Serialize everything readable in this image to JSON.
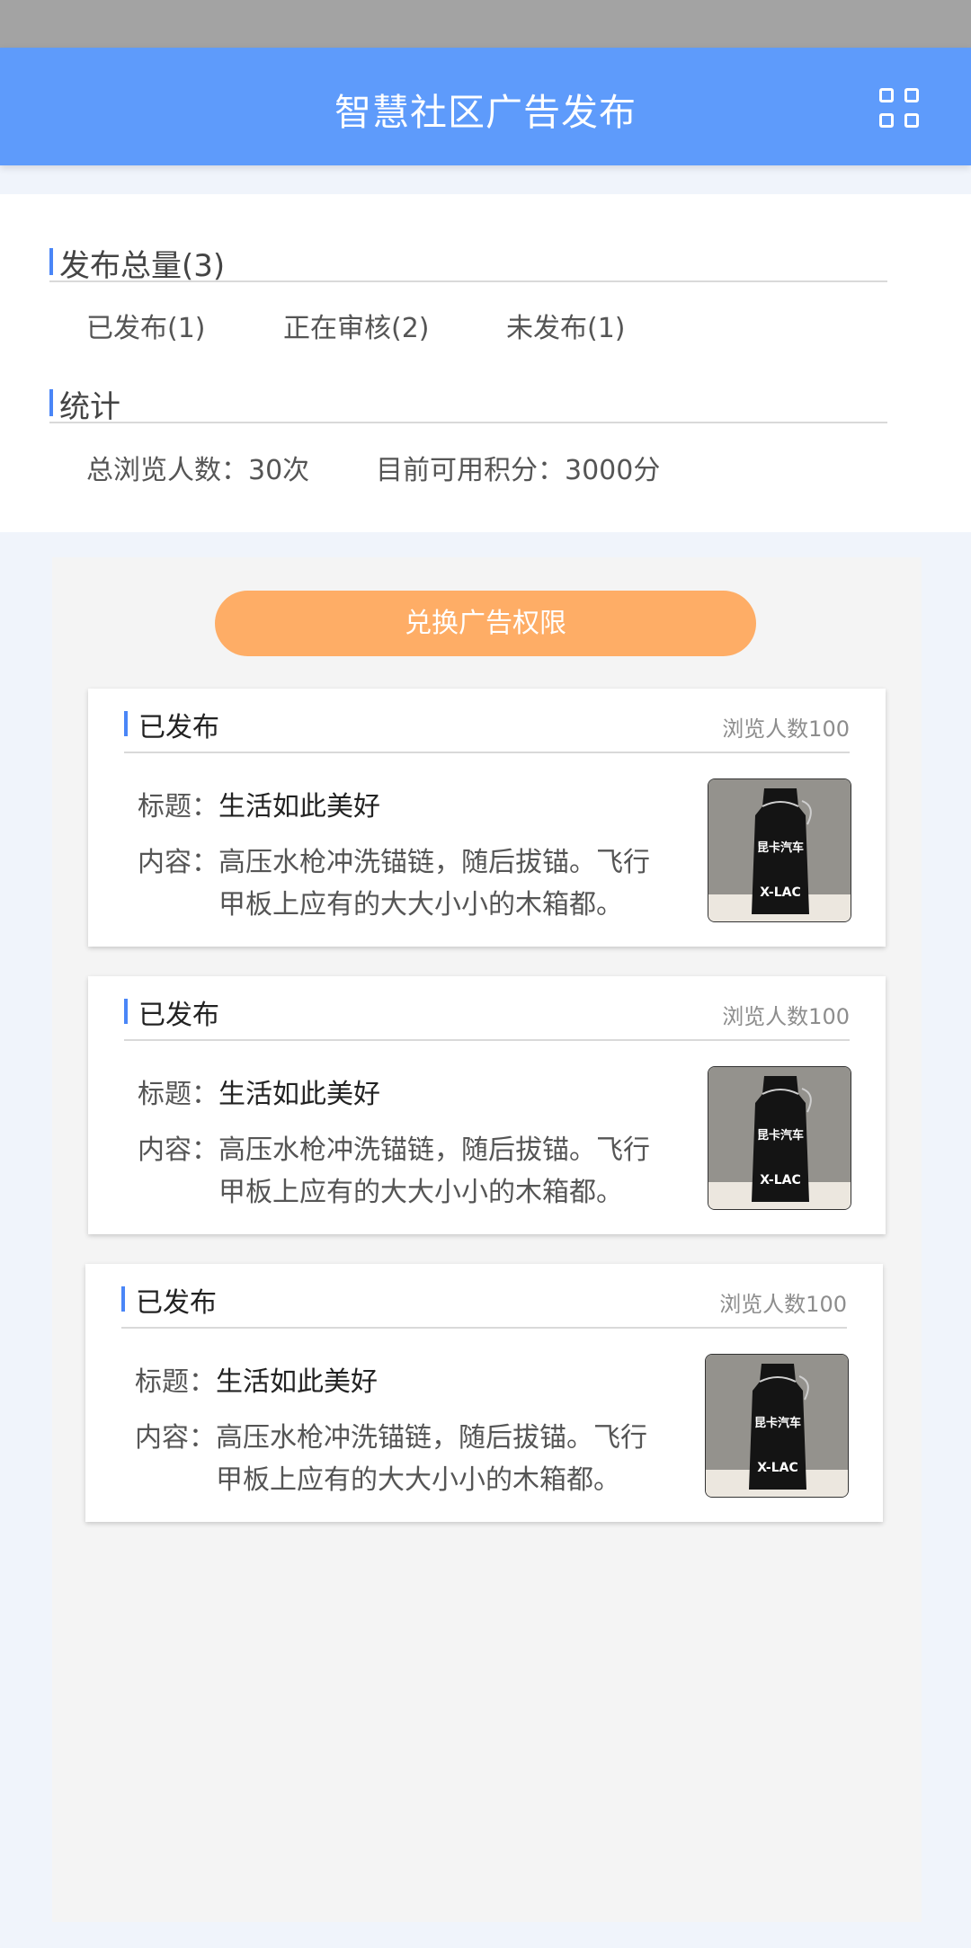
{
  "header": {
    "title": "智慧社区广告发布",
    "menu_icon": "grid-menu-icon"
  },
  "summary": {
    "total_title": "发布总量(3)",
    "published": "已发布(1)",
    "reviewing": "正在审核(2)",
    "unpublished": "未发布(1)",
    "stats_title": "统计",
    "total_views": "总浏览人数：30次",
    "points": "目前可用积分：3000分"
  },
  "exchange_button": "兑换广告权限",
  "ads": [
    {
      "status": "已发布",
      "views": "浏览人数100",
      "title_label": "标题：",
      "title": "生活如此美好",
      "content_label": "内容：",
      "content": "高压水枪冲洗锚链，随后拔锚。飞行甲板上应有的大大小小的木箱都。",
      "thumb_text": "昆卡汽车",
      "thumb_logo": "X-LAC"
    },
    {
      "status": "已发布",
      "views": "浏览人数100",
      "title_label": "标题：",
      "title": "生活如此美好",
      "content_label": "内容：",
      "content": "高压水枪冲洗锚链，随后拔锚。飞行甲板上应有的大大小小的木箱都。",
      "thumb_text": "昆卡汽车",
      "thumb_logo": "X-LAC"
    },
    {
      "status": "已发布",
      "views": "浏览人数100",
      "title_label": "标题：",
      "title": "生活如此美好",
      "content_label": "内容：",
      "content": "高压水枪冲洗锚链，随后拔锚。飞行甲板上应有的大大小小的木箱都。",
      "thumb_text": "昆卡汽车",
      "thumb_logo": "X-LAC"
    }
  ],
  "colors": {
    "header_bg": "#5e9bfb",
    "accent": "#4a86f7",
    "button_bg": "#fead66"
  }
}
